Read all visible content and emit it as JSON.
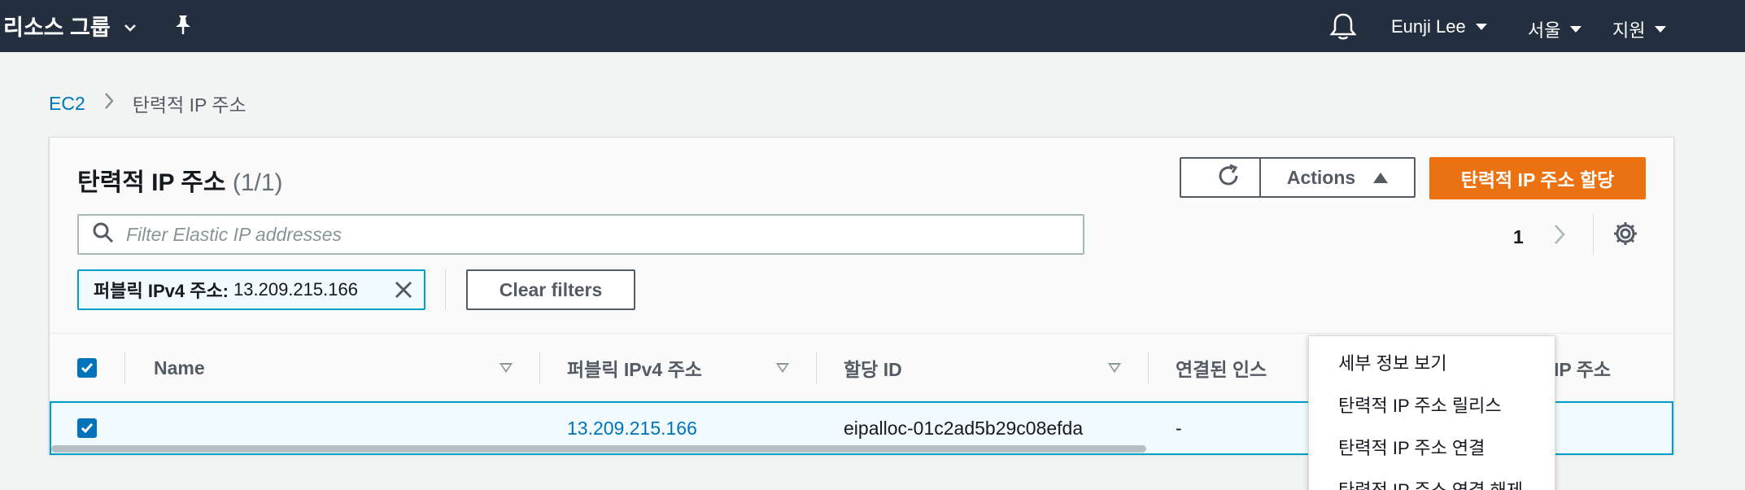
{
  "topnav": {
    "resource_groups": "리소스 그룹",
    "user": "Eunji Lee",
    "region": "서울",
    "support": "지원"
  },
  "breadcrumb": {
    "root": "EC2",
    "current": "탄력적 IP 주소"
  },
  "panel": {
    "title": "탄력적 IP 주소",
    "count": "(1/1)",
    "actions_label": "Actions",
    "allocate_label": "탄력적 IP 주소 할당",
    "search_placeholder": "Filter Elastic IP addresses",
    "page_number": "1",
    "filter_token": {
      "key": "퍼블릭 IPv4 주소:",
      "value": "13.209.215.166"
    },
    "clear_filters_label": "Clear filters"
  },
  "table": {
    "columns": [
      "Name",
      "퍼블릭 IPv4 주소",
      "할당 ID",
      "연결된 인스",
      "프라이빗 IP 주소"
    ],
    "rows": [
      {
        "name": "",
        "public_ip": "13.209.215.166",
        "allocation_id": "eipalloc-01c2ad5b29c08efda",
        "instance": "-",
        "private_ip": "-"
      }
    ]
  },
  "actions_menu": {
    "items": [
      "세부 정보 보기",
      "탄력적 IP 주소 릴리스",
      "탄력적 IP 주소 연결",
      "탄력적 IP 주소 연결 해제"
    ]
  },
  "colors": {
    "nav_bg": "#232f3e",
    "primary": "#ec7211",
    "link": "#0073bb",
    "selection_border": "#00a1c9"
  }
}
